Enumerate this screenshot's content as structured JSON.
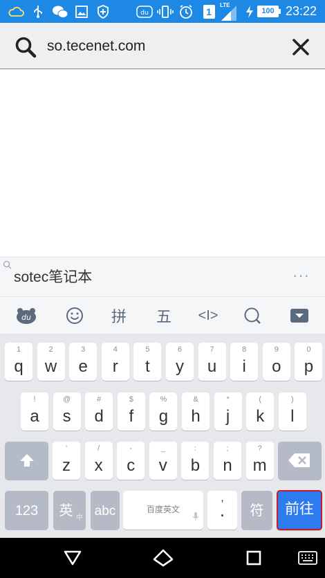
{
  "status_bar": {
    "time": "23:22",
    "battery": "100",
    "network": "LTE",
    "sim_slot": "1",
    "icons": [
      "weather-cloud-icon",
      "usb-icon",
      "wechat-icon",
      "image-icon",
      "shield-icon",
      "baidu-input-icon",
      "vibrate-icon",
      "alarm-icon",
      "sim-1-icon",
      "signal-icon",
      "charging-icon",
      "battery-icon"
    ]
  },
  "search": {
    "value": "so.tecenet.com",
    "left_icon": "search-icon",
    "right_icon": "close-icon"
  },
  "candidate": {
    "text": "sotec笔记本",
    "more": "···"
  },
  "toolbar": {
    "items": [
      "du-logo-icon",
      "emoji-icon",
      "拼",
      "五",
      "<I>",
      "search-icon",
      "collapse-keyboard-icon"
    ]
  },
  "keyboard": {
    "row1": [
      {
        "k": "q",
        "s": "1"
      },
      {
        "k": "w",
        "s": "2"
      },
      {
        "k": "e",
        "s": "3"
      },
      {
        "k": "r",
        "s": "4"
      },
      {
        "k": "t",
        "s": "5"
      },
      {
        "k": "y",
        "s": "6"
      },
      {
        "k": "u",
        "s": "7"
      },
      {
        "k": "i",
        "s": "8"
      },
      {
        "k": "o",
        "s": "9"
      },
      {
        "k": "p",
        "s": "0"
      }
    ],
    "row2": [
      {
        "k": "a",
        "s": "!"
      },
      {
        "k": "s",
        "s": "@"
      },
      {
        "k": "d",
        "s": "#"
      },
      {
        "k": "f",
        "s": "$"
      },
      {
        "k": "g",
        "s": "%"
      },
      {
        "k": "h",
        "s": "&"
      },
      {
        "k": "j",
        "s": "*"
      },
      {
        "k": "k",
        "s": "("
      },
      {
        "k": "l",
        "s": ")"
      }
    ],
    "row3": [
      {
        "k": "z",
        "s": "'"
      },
      {
        "k": "x",
        "s": "/"
      },
      {
        "k": "c",
        "s": "-"
      },
      {
        "k": "v",
        "s": "_"
      },
      {
        "k": "b",
        "s": ":"
      },
      {
        "k": "n",
        "s": ";"
      },
      {
        "k": "m",
        "s": "?"
      }
    ],
    "shift_icon": "shift-icon",
    "backspace_icon": "backspace-icon",
    "numbers_label": "123",
    "lang_label": "英",
    "lang_sub": "中",
    "abc_label": "abc",
    "space_label": "百度英文",
    "mic_icon": "mic-icon",
    "punct_main": ".",
    "punct_sub": ",",
    "symbols_label": "符",
    "go_label": "前往"
  },
  "nav_bar": {
    "back_icon": "back-triangle-icon",
    "home_icon": "home-icon",
    "recents_icon": "recents-square-icon",
    "keyboard_icon": "keyboard-icon"
  }
}
